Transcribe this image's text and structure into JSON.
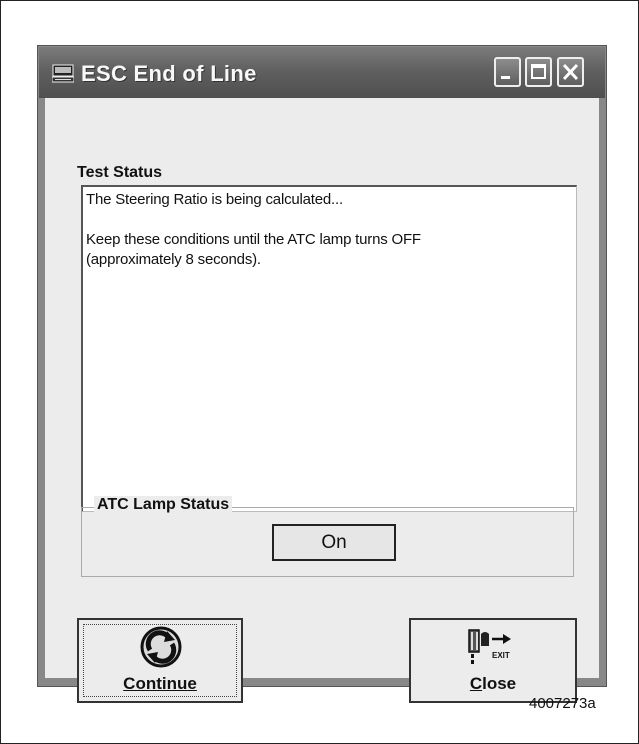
{
  "window": {
    "title": "ESC End of Line",
    "caption_buttons": [
      "minimize",
      "maximize",
      "close"
    ]
  },
  "test_status": {
    "label": "Test Status",
    "lines": [
      "The Steering Ratio is being calculated...",
      "",
      "Keep these conditions until the ATC lamp turns OFF",
      "(approximately 8 seconds)."
    ]
  },
  "atc_lamp": {
    "group_label": "ATC Lamp Status",
    "value": "On"
  },
  "buttons": {
    "continue": {
      "label": "Continue",
      "icon": "refresh-icon"
    },
    "close": {
      "label_mnemonic": "C",
      "label_rest": "lose",
      "icon": "exit-icon",
      "icon_text": "EXIT"
    }
  },
  "figure_id": "4007273a"
}
